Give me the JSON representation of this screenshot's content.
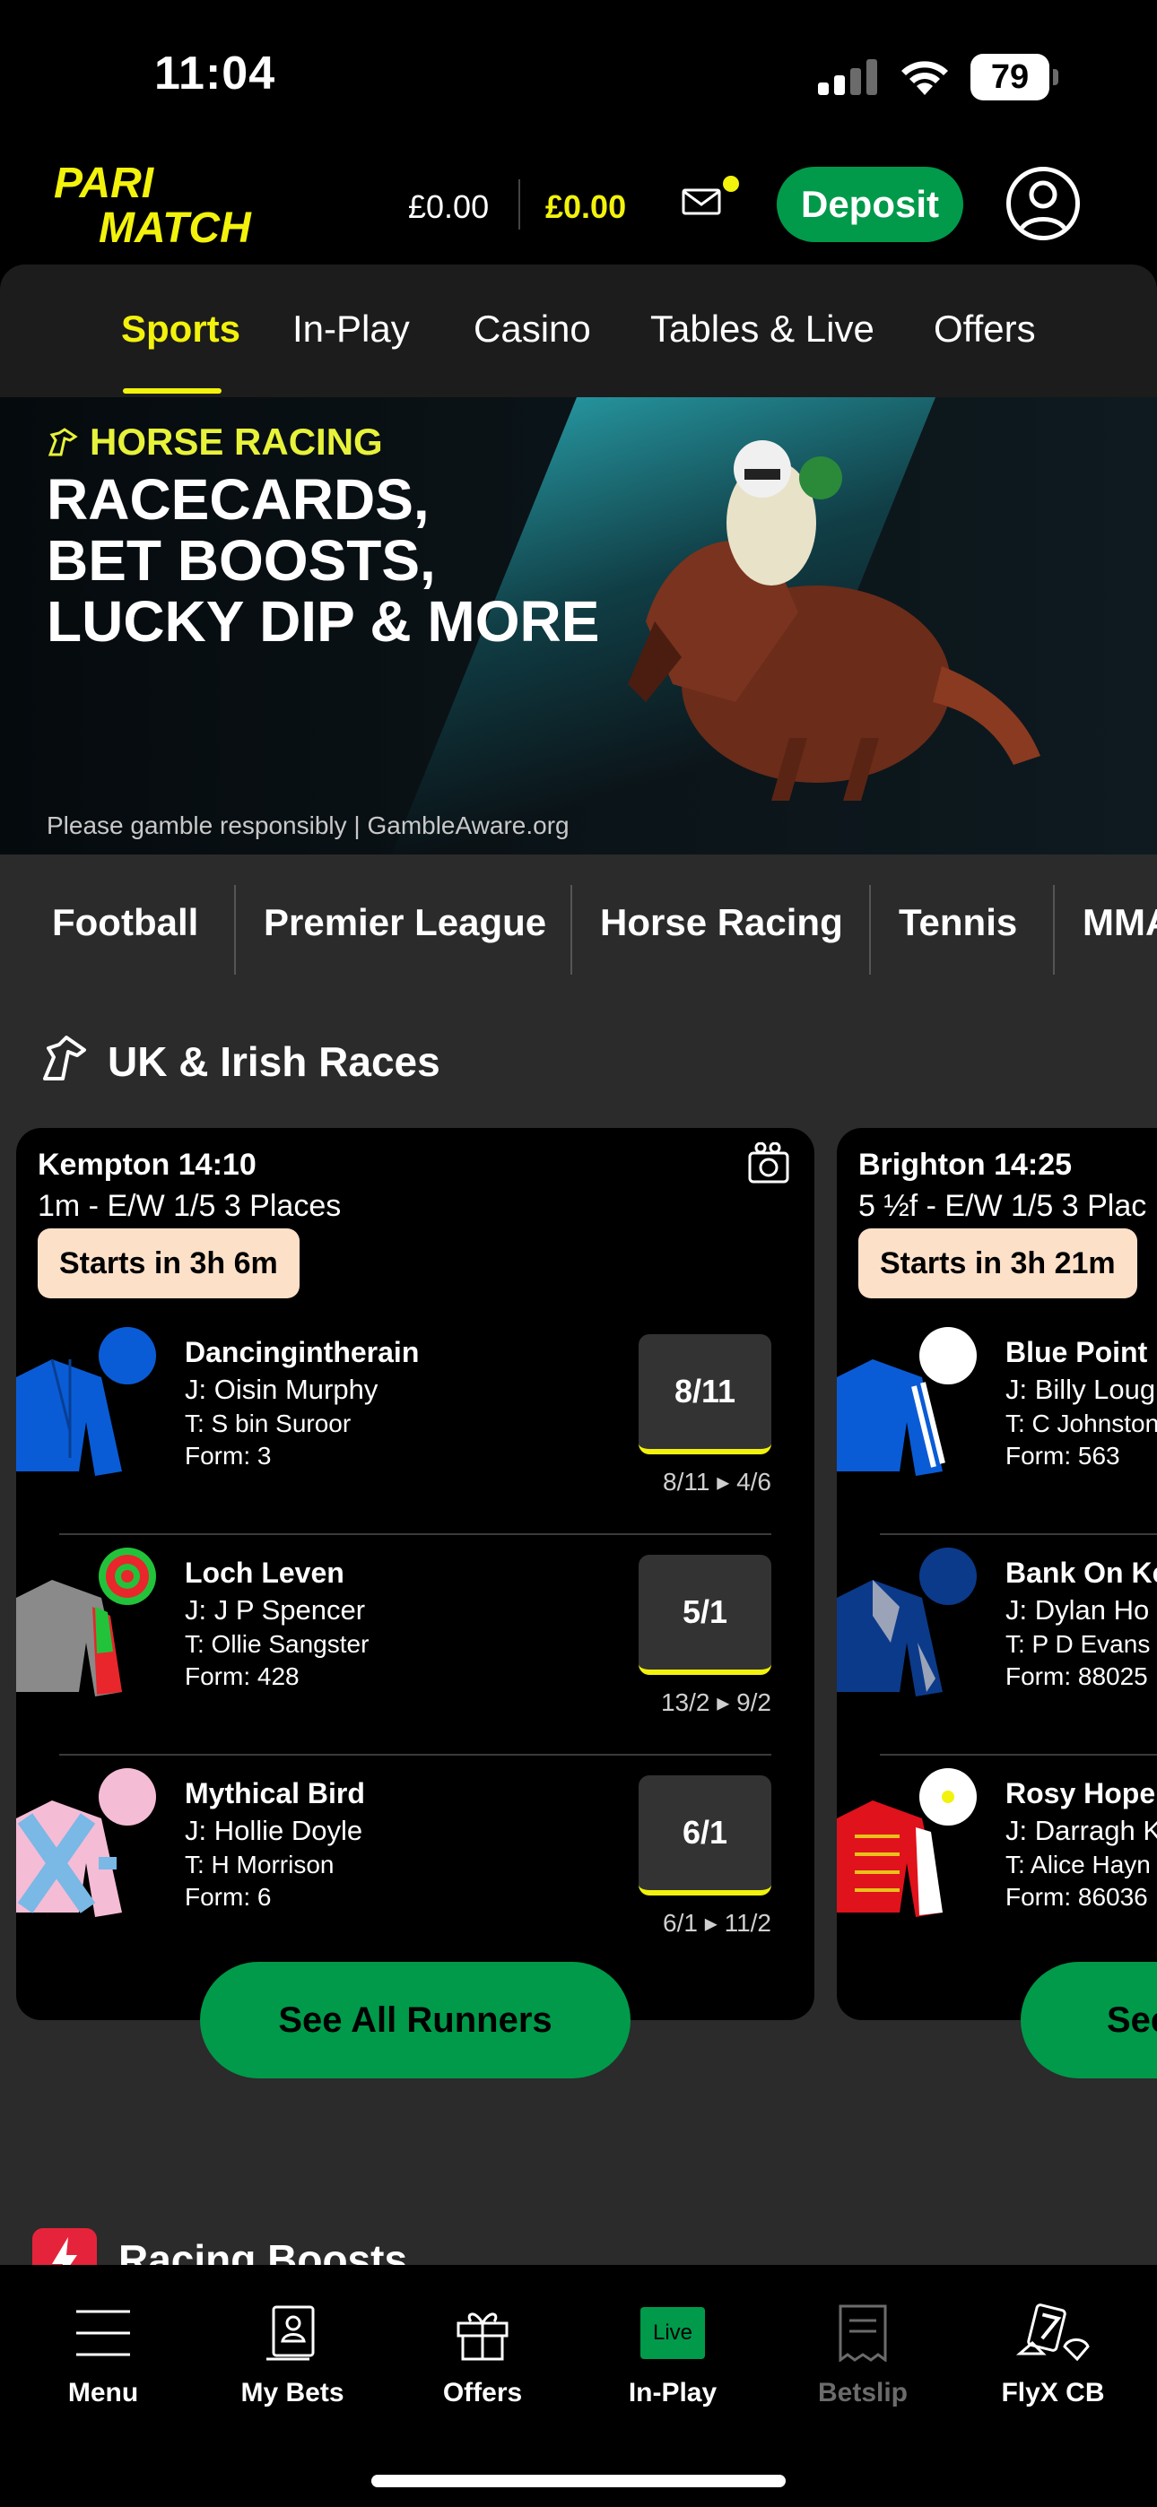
{
  "status": {
    "time": "11:04",
    "battery": "79"
  },
  "header": {
    "balance_1": "£0.00",
    "balance_2": "£0.00",
    "deposit_label": "Deposit"
  },
  "nav": {
    "tabs": [
      {
        "label": "Sports",
        "active": true
      },
      {
        "label": "In-Play",
        "active": false
      },
      {
        "label": "Casino",
        "active": false
      },
      {
        "label": "Tables & Live",
        "active": false
      },
      {
        "label": "Offers",
        "active": false
      }
    ]
  },
  "banner": {
    "kicker": "HORSE RACING",
    "headline": "RACECARDS,\nBET BOOSTS,\nLUCKY DIP & MORE",
    "footer": "Please gamble responsibly | GambleAware.org"
  },
  "sport_chips": [
    "Football",
    "Premier League",
    "Horse Racing",
    "Tennis",
    "MMA"
  ],
  "section": {
    "title": "UK & Irish Races"
  },
  "races": [
    {
      "title": "Kempton 14:10",
      "subtitle": "1m - E/W 1/5 3 Places",
      "starts": "Starts in 3h 6m",
      "see_all": "See All Runners",
      "runners": [
        {
          "name": "Dancingintherain",
          "jockey": "J: Oisin Murphy",
          "trainer": "T: S bin Suroor",
          "form": "Form:  3",
          "odds": "8/11",
          "odds_prev": "8/11",
          "odds_now": "4/6"
        },
        {
          "name": "Loch Leven",
          "jockey": "J: J P Spencer",
          "trainer": "T: Ollie Sangster",
          "form": "Form:  428",
          "odds": "5/1",
          "odds_prev": "13/2",
          "odds_now": "9/2"
        },
        {
          "name": "Mythical Bird",
          "jockey": "J: Hollie Doyle",
          "trainer": "T: H Morrison",
          "form": "Form:  6",
          "odds": "6/1",
          "odds_prev": "6/1",
          "odds_now": "11/2"
        }
      ]
    },
    {
      "title": "Brighton 14:25",
      "subtitle": "5 ½f - E/W 1/5 3 Plac",
      "starts": "Starts in 3h 21m",
      "see_all": "See",
      "runners": [
        {
          "name": "Blue Point E",
          "jockey": "J: Billy Loug",
          "trainer": "T: C Johnston",
          "form": "Form:  563"
        },
        {
          "name": "Bank On Ke",
          "jockey": "J: Dylan Ho",
          "trainer": "T: P D Evans",
          "form": "Form:  88025"
        },
        {
          "name": "Rosy Hope",
          "jockey": "J: Darragh K",
          "trainer": "T: Alice Hayn",
          "form": "Form:  86036"
        }
      ]
    }
  ],
  "next_section": {
    "title": "Racing Boosts"
  },
  "tabbar": {
    "items": [
      {
        "label": "Menu",
        "icon": "menu-icon"
      },
      {
        "label": "My Bets",
        "icon": "my-bets-icon"
      },
      {
        "label": "Offers",
        "icon": "gift-icon"
      },
      {
        "label": "In-Play",
        "icon": "live-badge",
        "badge": "Live"
      },
      {
        "label": "Betslip",
        "icon": "betslip-icon",
        "disabled": true
      },
      {
        "label": "FlyX CB",
        "icon": "flyx-icon"
      }
    ]
  },
  "colors": {
    "accent_yellow": "#f2f20d",
    "brand_green": "#009a4a",
    "background": "#2b2b2b"
  }
}
